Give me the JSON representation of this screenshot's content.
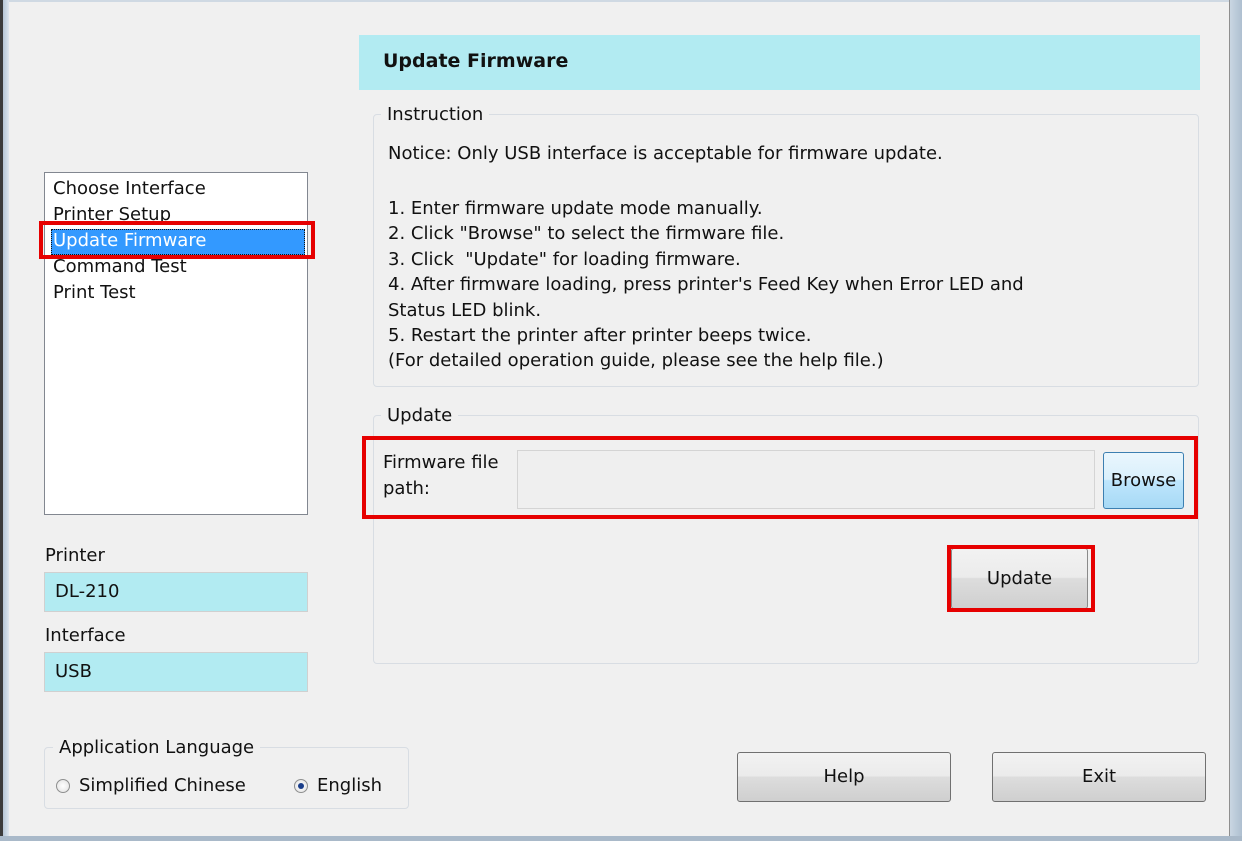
{
  "window": {
    "panel_title": "Update Firmware"
  },
  "nav": {
    "items": [
      {
        "label": "Choose Interface"
      },
      {
        "label": "Printer Setup"
      },
      {
        "label": "Update Firmware"
      },
      {
        "label": "Command Test"
      },
      {
        "label": "Print Test"
      }
    ],
    "selected": "Update Firmware"
  },
  "printer": {
    "label": "Printer",
    "value": "DL-210"
  },
  "interface": {
    "label": "Interface",
    "value": "USB"
  },
  "language": {
    "legend": "Application Language",
    "options": [
      {
        "label": "Simplified Chinese",
        "selected": false
      },
      {
        "label": "English",
        "selected": true
      }
    ]
  },
  "instruction": {
    "legend": "Instruction",
    "notice": "Notice: Only USB interface is acceptable for firmware update.",
    "lines": [
      "1. Enter firmware update mode manually.",
      "2. Click \"Browse\" to select the firmware file.",
      "3. Click  \"Update\" for loading firmware.",
      "4. After firmware loading, press printer's Feed Key when Error LED and",
      "Status LED blink.",
      "5. Restart the printer after printer beeps twice.",
      "(For detailed operation guide, please see the help file.)"
    ]
  },
  "update": {
    "legend": "Update",
    "file_path_label_line1": "Firmware file",
    "file_path_label_line2": "path:",
    "file_path_value": "",
    "browse_label": "Browse",
    "update_label": "Update"
  },
  "footer": {
    "help_label": "Help",
    "exit_label": "Exit"
  },
  "colors": {
    "title_bg": "#b2ebf2",
    "selection": "#3399ff",
    "highlight_box": "#e60000"
  }
}
